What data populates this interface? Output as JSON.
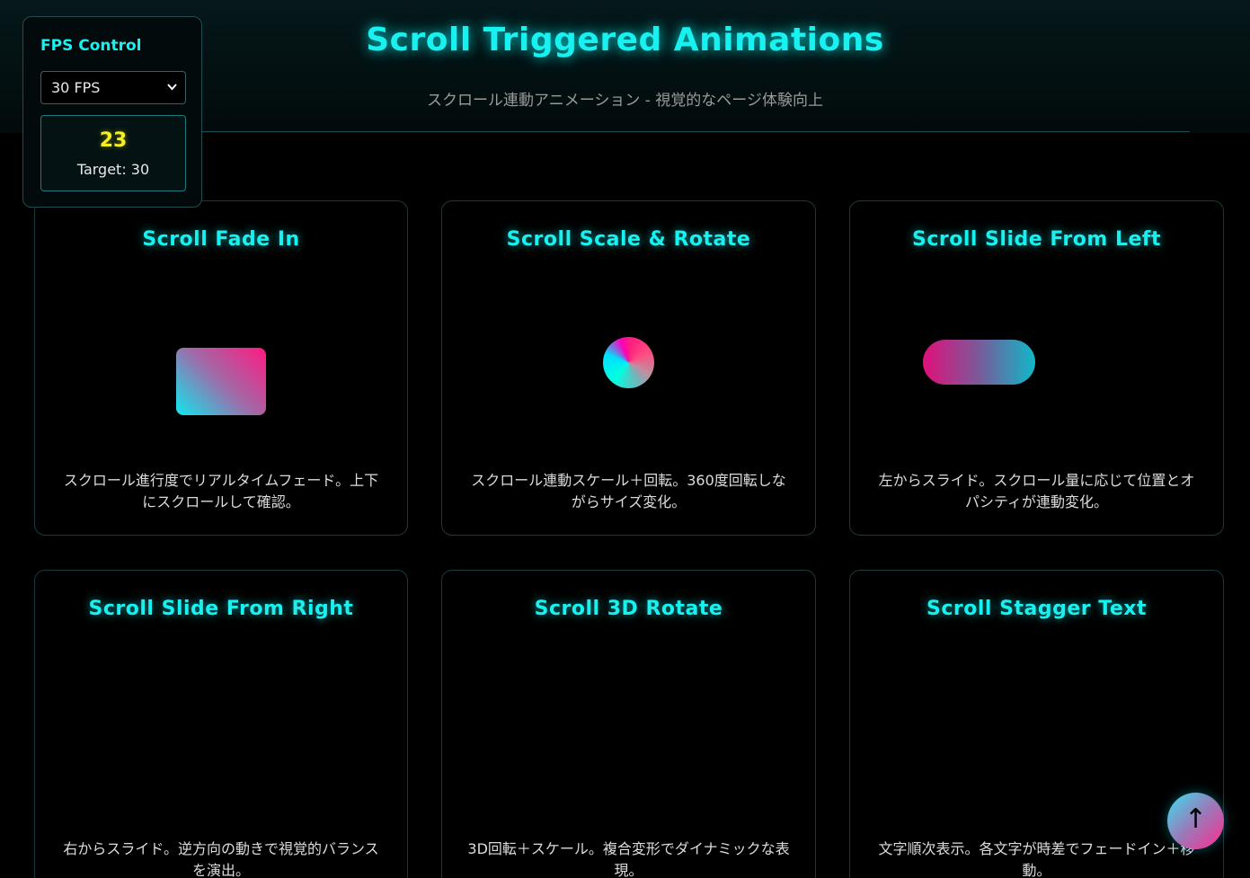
{
  "header": {
    "title": "Scroll Triggered Animations",
    "subtitle": "スクロール連動アニメーション - 視覚的なページ体験向上"
  },
  "fps_control": {
    "title": "FPS Control",
    "selected": "30 FPS",
    "current_fps": "23",
    "target_label": "Target: 30"
  },
  "cards": [
    {
      "title": "Scroll Fade In",
      "description": "スクロール進行度でリアルタイムフェード。上下にスクロールして確認。",
      "shape": "gradient-square"
    },
    {
      "title": "Scroll Scale & Rotate",
      "description": "スクロール連動スケール＋回転。360度回転しながらサイズ変化。",
      "shape": "gradient-circle"
    },
    {
      "title": "Scroll Slide From Left",
      "description": "左からスライド。スクロール量に応じて位置とオパシティが連動変化。",
      "shape": "gradient-pill"
    },
    {
      "title": "Scroll Slide From Right",
      "description": "右からスライド。逆方向の動きで視覚的バランスを演出。"
    },
    {
      "title": "Scroll 3D Rotate",
      "description": "3D回転＋スケール。複合変形でダイナミックな表現。"
    },
    {
      "title": "Scroll Stagger Text",
      "description": "文字順次表示。各文字が時差でフェードイン＋移動。"
    }
  ],
  "scroll_top": {
    "icon": "arrow-up-icon",
    "glyph": "↑"
  },
  "colors": {
    "accent": "#19f0f0",
    "fps_value": "#f7f020",
    "background": "#000000",
    "card_border": "#183a3d"
  }
}
